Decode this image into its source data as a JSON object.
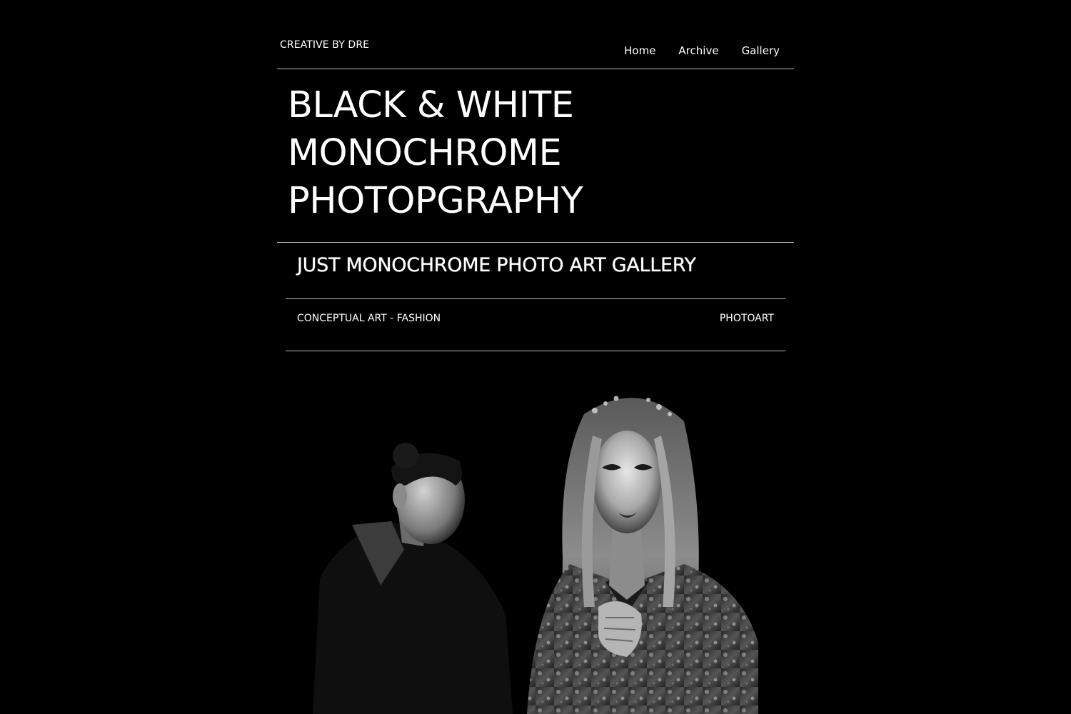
{
  "header": {
    "site_name": "CREATIVE BY DRE",
    "nav": [
      "Home",
      "Archive",
      "Gallery"
    ]
  },
  "hero": {
    "title_lines": [
      "BLACK & WHITE",
      "MONOCHROME",
      "PHOTOPGRAPHY"
    ]
  },
  "section": {
    "subtitle": "JUST MONOCHROME PHOTO ART GALLERY",
    "category_left": "CONCEPTUAL ART - FASHION",
    "category_right": "PHOTOART"
  },
  "colors": {
    "background": "#000000",
    "text": "#ffffff",
    "rule": "#bdbdbd"
  }
}
